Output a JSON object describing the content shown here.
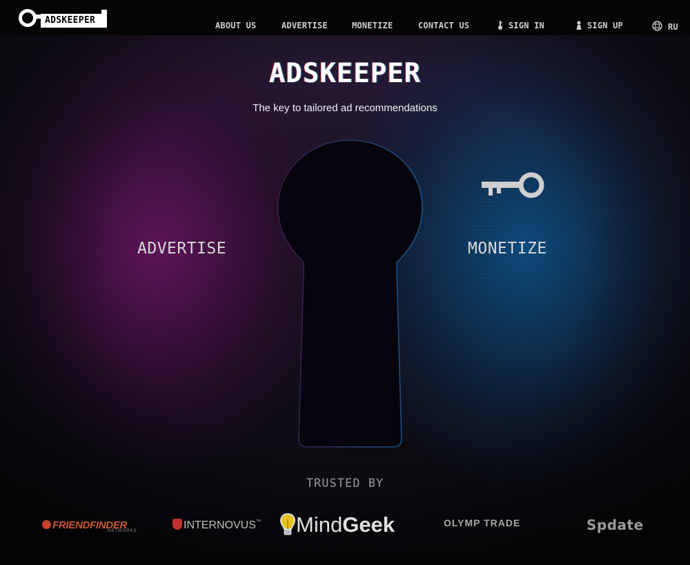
{
  "brand": {
    "logo_text": "ADSKEEPER"
  },
  "nav": {
    "items": [
      {
        "label": "ABOUT US"
      },
      {
        "label": "ADVERTISE"
      },
      {
        "label": "MONETIZE"
      },
      {
        "label": "CONTACT US"
      },
      {
        "label": "SIGN IN",
        "icon": "key-icon"
      },
      {
        "label": "SIGN UP",
        "icon": "user-icon"
      },
      {
        "label": "RU",
        "icon": "globe-icon"
      }
    ]
  },
  "hero": {
    "title": "ADSKEEPER",
    "subtitle": "The key to tailored ad recommendations",
    "advertise_label": "ADVERTISE",
    "monetize_label": "MONETIZE"
  },
  "trusted": {
    "heading": "TRUSTED BY",
    "partners": [
      {
        "name": "FRIENDFINDER",
        "sub": "NETWORKS"
      },
      {
        "name": "INTERNOVUS",
        "tm": "™"
      },
      {
        "name_light": "Mind",
        "name_bold": "Geek"
      },
      {
        "name": "OLYMP TRADE"
      },
      {
        "name": "Spdate"
      }
    ]
  },
  "colors": {
    "header_bg": "#050506",
    "left_glow": "#78146e",
    "right_glow": "#0a5a96",
    "friendfinder": "#c65a2e",
    "internovus_mark": "#c03030"
  }
}
